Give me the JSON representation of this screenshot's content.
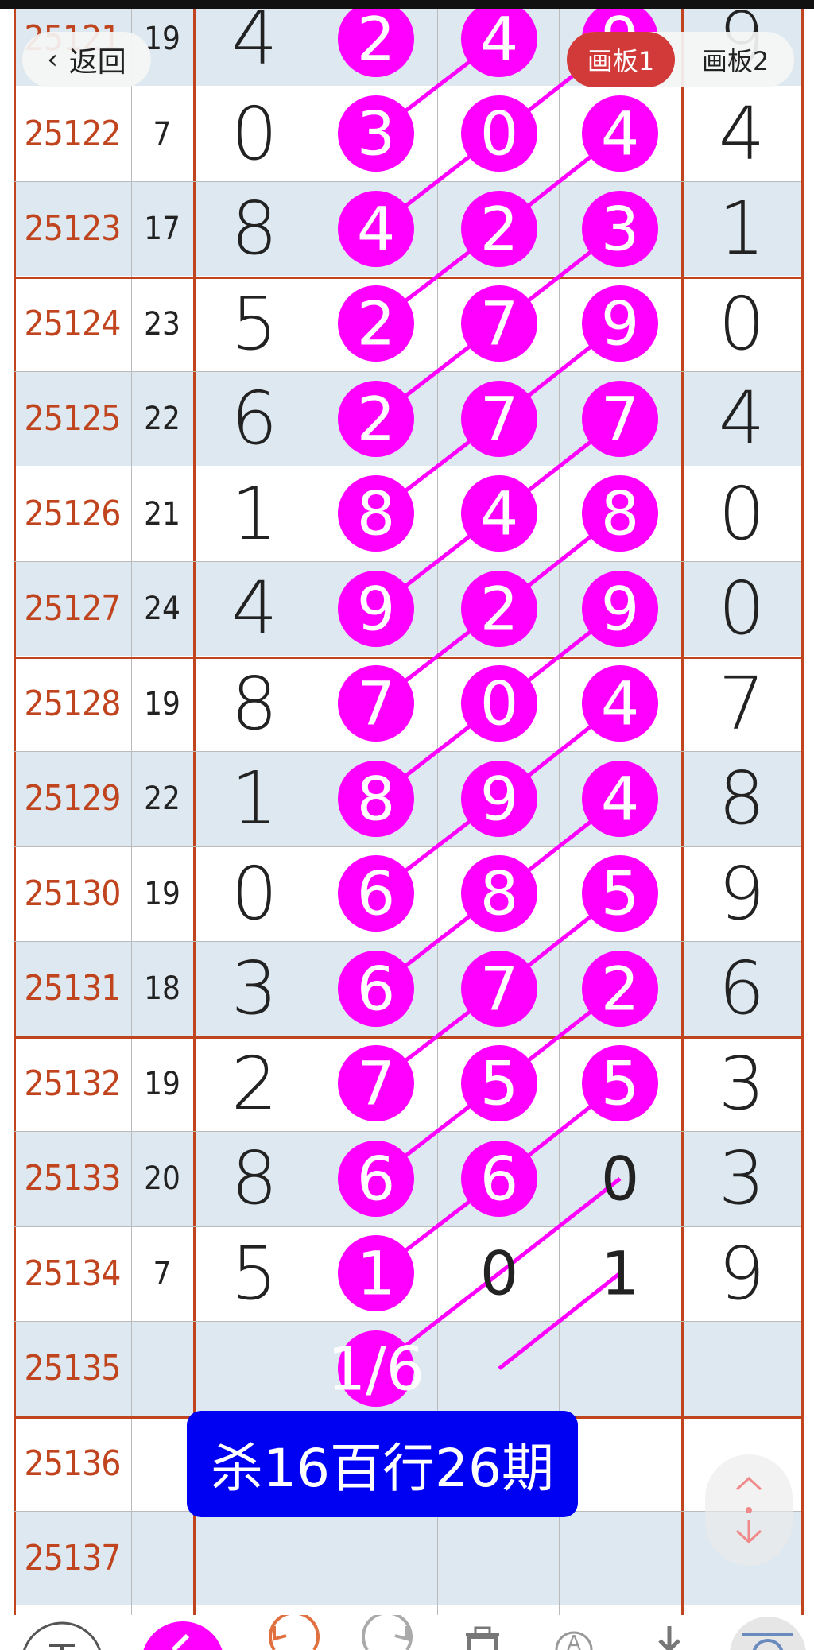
{
  "top_buttons": {
    "back_label": "返回",
    "board1_label": "画板1",
    "board2_label": "画板2"
  },
  "rows": [
    {
      "issue": "25121",
      "sum": "19",
      "d1": "4",
      "b1": "2",
      "b2": "4",
      "b3": "9",
      "d5": "9",
      "shade": "b"
    },
    {
      "issue": "25122",
      "sum": "7",
      "d1": "0",
      "b1": "3",
      "b2": "0",
      "b3": "4",
      "d5": "4",
      "shade": "w"
    },
    {
      "issue": "25123",
      "sum": "17",
      "d1": "8",
      "b1": "4",
      "b2": "2",
      "b3": "3",
      "d5": "1",
      "shade": "b"
    },
    {
      "issue": "25124",
      "sum": "23",
      "d1": "5",
      "b1": "2",
      "b2": "7",
      "b3": "9",
      "d5": "0",
      "shade": "w"
    },
    {
      "issue": "25125",
      "sum": "22",
      "d1": "6",
      "b1": "2",
      "b2": "7",
      "b3": "7",
      "d5": "4",
      "shade": "b"
    },
    {
      "issue": "25126",
      "sum": "21",
      "d1": "1",
      "b1": "8",
      "b2": "4",
      "b3": "8",
      "d5": "0",
      "shade": "w"
    },
    {
      "issue": "25127",
      "sum": "24",
      "d1": "4",
      "b1": "9",
      "b2": "2",
      "b3": "9",
      "d5": "0",
      "shade": "b"
    },
    {
      "issue": "25128",
      "sum": "19",
      "d1": "8",
      "b1": "7",
      "b2": "0",
      "b3": "4",
      "d5": "7",
      "shade": "w"
    },
    {
      "issue": "25129",
      "sum": "22",
      "d1": "1",
      "b1": "8",
      "b2": "9",
      "b3": "4",
      "d5": "8",
      "shade": "b"
    },
    {
      "issue": "25130",
      "sum": "19",
      "d1": "0",
      "b1": "6",
      "b2": "8",
      "b3": "5",
      "d5": "9",
      "shade": "w"
    },
    {
      "issue": "25131",
      "sum": "18",
      "d1": "3",
      "b1": "6",
      "b2": "7",
      "b3": "2",
      "d5": "6",
      "shade": "b"
    },
    {
      "issue": "25132",
      "sum": "19",
      "d1": "2",
      "b1": "7",
      "b2": "5",
      "b3": "5",
      "d5": "3",
      "shade": "w"
    },
    {
      "issue": "25133",
      "sum": "20",
      "d1": "8",
      "b1": "6",
      "b2": "6",
      "b3": "0",
      "d5": "3",
      "shade": "b"
    },
    {
      "issue": "25134",
      "sum": "7",
      "d1": "5",
      "b1": "1",
      "b2": "0",
      "b3": "1",
      "d5": "9",
      "shade": "w"
    },
    {
      "issue": "25135",
      "sum": "",
      "d1": "",
      "b1": "1/6",
      "b2": "",
      "b3": "",
      "d5": "",
      "shade": "b"
    },
    {
      "issue": "25136",
      "sum": "",
      "d1": "",
      "b1": "",
      "b2": "",
      "b3": "",
      "d5": "",
      "shade": "w"
    },
    {
      "issue": "25137",
      "sum": "",
      "d1": "",
      "b1": "",
      "b2": "",
      "b3": "",
      "d5": "",
      "shade": "b"
    }
  ],
  "annotation": {
    "text": "杀16百行26期"
  },
  "colors": {
    "ball": "#ff00ff",
    "issue_text": "#c0441d",
    "note_bg": "#0000f2",
    "tab_active": "#d23a3a",
    "grid_red": "#c0441d"
  },
  "toolbar": {
    "icons": [
      "text-tool-icon",
      "pen-tool-icon",
      "undo-icon",
      "redo-icon",
      "trash-icon",
      "shape-icon",
      "download-icon",
      "settings-icon"
    ]
  }
}
